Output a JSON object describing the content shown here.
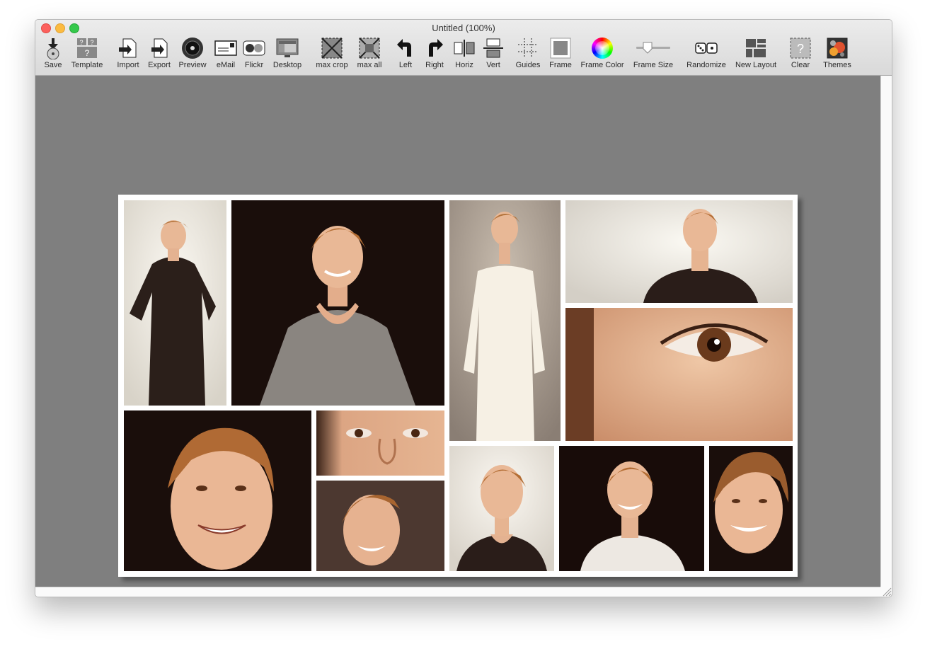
{
  "window": {
    "title": "Untitled (100%)"
  },
  "toolbar": {
    "save": "Save",
    "template": "Template",
    "import": "Import",
    "export": "Export",
    "preview": "Preview",
    "email": "eMail",
    "flickr": "Flickr",
    "desktop": "Desktop",
    "max_crop": "max crop",
    "max_all": "max all",
    "left": "Left",
    "right": "Right",
    "horiz": "Horiz",
    "vert": "Vert",
    "guides": "Guides",
    "frame": "Frame",
    "frame_color": "Frame Color",
    "frame_size": "Frame Size",
    "randomize": "Randomize",
    "new_layout": "New Layout",
    "clear": "Clear",
    "themes": "Themes"
  },
  "colors": {
    "canvas_bg": "#7f7f7f",
    "frame": "#ffffff",
    "photo_dark": "#1d100c",
    "photo_light": "#f4efe6",
    "skin": "#e6b08f",
    "hair": "#b0703c"
  }
}
